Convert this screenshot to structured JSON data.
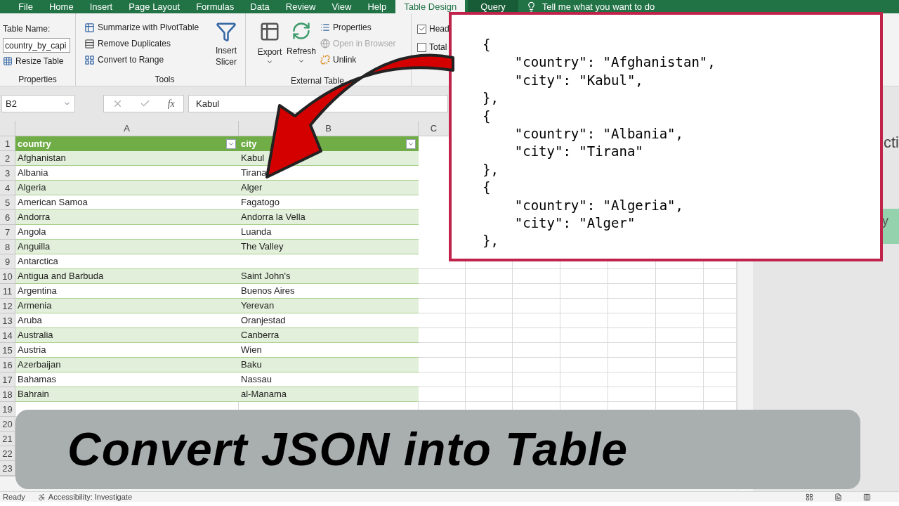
{
  "menu_tabs": [
    {
      "label": "File",
      "selected": false
    },
    {
      "label": "Home",
      "selected": false
    },
    {
      "label": "Insert",
      "selected": false
    },
    {
      "label": "Page Layout",
      "selected": false
    },
    {
      "label": "Formulas",
      "selected": false
    },
    {
      "label": "Data",
      "selected": false
    },
    {
      "label": "Review",
      "selected": false
    },
    {
      "label": "View",
      "selected": false
    },
    {
      "label": "Help",
      "selected": false
    },
    {
      "label": "Table Design",
      "selected": true
    },
    {
      "label": "Query",
      "selected": false
    }
  ],
  "tell_me": "Tell me what you want to do",
  "ribbon": {
    "table_name_label": "Table Name:",
    "table_name_value": "country_by_capi",
    "resize_table": "Resize Table",
    "properties_group": "Properties",
    "tools": [
      "Summarize with PivotTable",
      "Remove Duplicates",
      "Convert to Range"
    ],
    "insert_slicer": "Insert Slicer",
    "tools_group": "Tools",
    "export": "Export",
    "refresh": "Refresh",
    "external": [
      {
        "label": "Properties",
        "disabled": false
      },
      {
        "label": "Open in Browser",
        "disabled": true
      },
      {
        "label": "Unlink",
        "disabled": false
      }
    ],
    "external_group": "External Table",
    "options": [
      {
        "label": "Head",
        "checked": true
      },
      {
        "label": "Total",
        "checked": false
      }
    ]
  },
  "formula_bar": {
    "name_box": "B2",
    "fx": "fx",
    "value": "Kabul"
  },
  "columns": [
    "A",
    "B",
    "C"
  ],
  "row_numbers": [
    "1",
    "2",
    "3",
    "4",
    "5",
    "6",
    "7",
    "8",
    "9",
    "10",
    "11",
    "12",
    "13",
    "14",
    "15",
    "16",
    "17",
    "18",
    "19",
    "20",
    "21",
    "22",
    "23"
  ],
  "table": {
    "headers": [
      "country",
      "city"
    ],
    "rows": [
      {
        "country": "Afghanistan",
        "city": "Kabul"
      },
      {
        "country": "Albania",
        "city": "Tirana"
      },
      {
        "country": "Algeria",
        "city": "Alger"
      },
      {
        "country": "American Samoa",
        "city": "Fagatogo"
      },
      {
        "country": "Andorra",
        "city": "Andorra la Vella"
      },
      {
        "country": "Angola",
        "city": "Luanda"
      },
      {
        "country": "Anguilla",
        "city": "The Valley"
      },
      {
        "country": "Antarctica"
      },
      {
        "country": "Antigua and Barbuda",
        "city": "Saint John's"
      },
      {
        "country": "Argentina",
        "city": "Buenos Aires"
      },
      {
        "country": "Armenia",
        "city": "Yerevan"
      },
      {
        "country": "Aruba",
        "city": "Oranjestad"
      },
      {
        "country": "Australia",
        "city": "Canberra"
      },
      {
        "country": "Austria",
        "city": "Wien"
      },
      {
        "country": "Azerbaijan",
        "city": "Baku"
      },
      {
        "country": "Bahamas",
        "city": "Nassau"
      },
      {
        "country": "Bahrain",
        "city": "al-Manama"
      }
    ]
  },
  "side_pane": {
    "heading": "cti",
    "item": "y"
  },
  "status_bar": {
    "ready": "Ready",
    "accessibility": "Accessibility: Investigate"
  },
  "json_panel": {
    "lines": [
      "{",
      "    \"country\": \"Afghanistan\",",
      "    \"city\": \"Kabul\",",
      "},",
      "{",
      "    \"country\": \"Albania\",",
      "    \"city\": \"Tirana\"",
      "},",
      "{",
      "    \"country\": \"Algeria\",",
      "    \"city\": \"Alger\"",
      "},"
    ]
  },
  "banner": {
    "title": "Convert JSON into Table"
  }
}
